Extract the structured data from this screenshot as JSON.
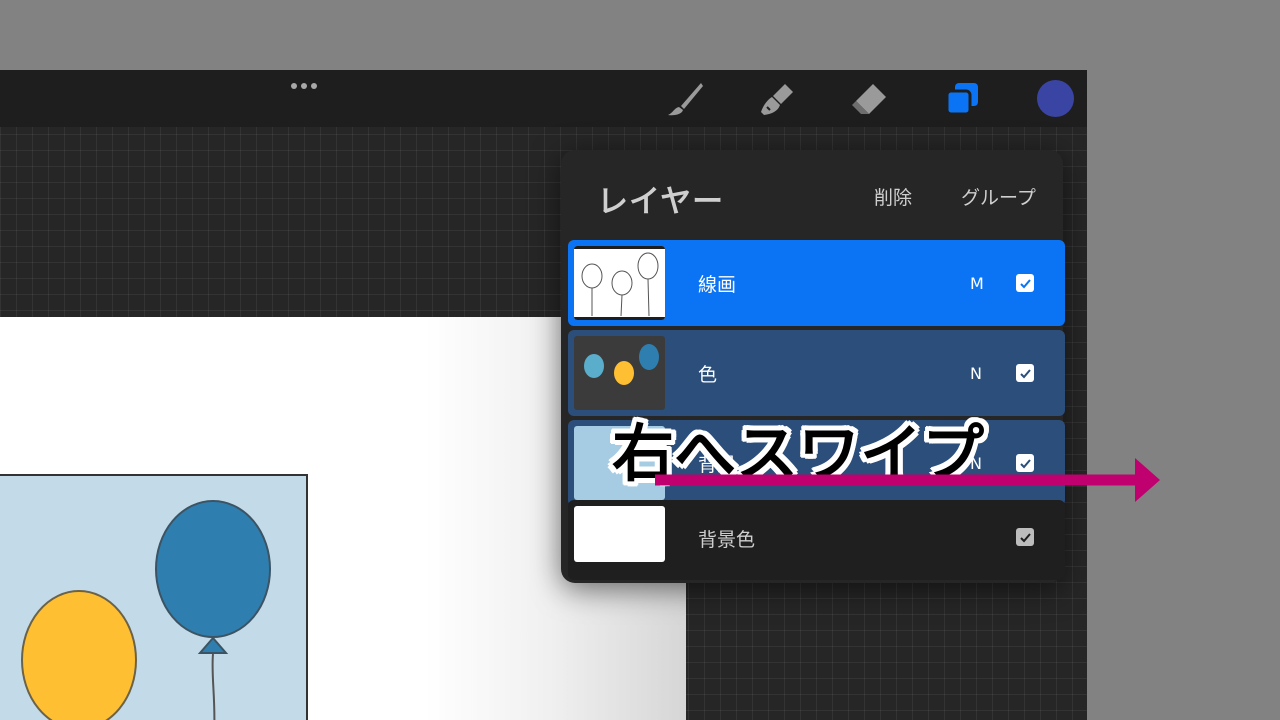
{
  "toolbar": {
    "menu_icon": "more-dots-icon",
    "tools": [
      {
        "name": "brush-icon",
        "color": "#9a9a9a"
      },
      {
        "name": "smudge-icon",
        "color": "#9a9a9a"
      },
      {
        "name": "eraser-icon",
        "color": "#9a9a9a"
      },
      {
        "name": "layers-icon",
        "color": "#0a74f5",
        "active": true
      }
    ],
    "current_color": "#3a45a3"
  },
  "layers_panel": {
    "title": "レイヤー",
    "delete_label": "削除",
    "group_label": "グループ",
    "layers": [
      {
        "name": "線画",
        "blend": "M",
        "visible": true,
        "state": "selected"
      },
      {
        "name": "色",
        "blend": "N",
        "visible": true,
        "state": "secondary"
      },
      {
        "name": "背景",
        "blend": "N",
        "visible": true,
        "state": "secondary"
      },
      {
        "name": "背景色",
        "blend": "",
        "visible": true,
        "state": "normal"
      }
    ]
  },
  "overlay": {
    "swipe_label": "右へスワイプ",
    "arrow_color": "#c0006e"
  },
  "colors": {
    "accent_blue": "#0a74f5",
    "secondary_blue": "#2b4e7b",
    "balloon_yellow": "#ffbf33",
    "balloon_blue": "#2e7faf",
    "balloon_teal": "#5aaecb",
    "sky": "#c3dae9"
  }
}
